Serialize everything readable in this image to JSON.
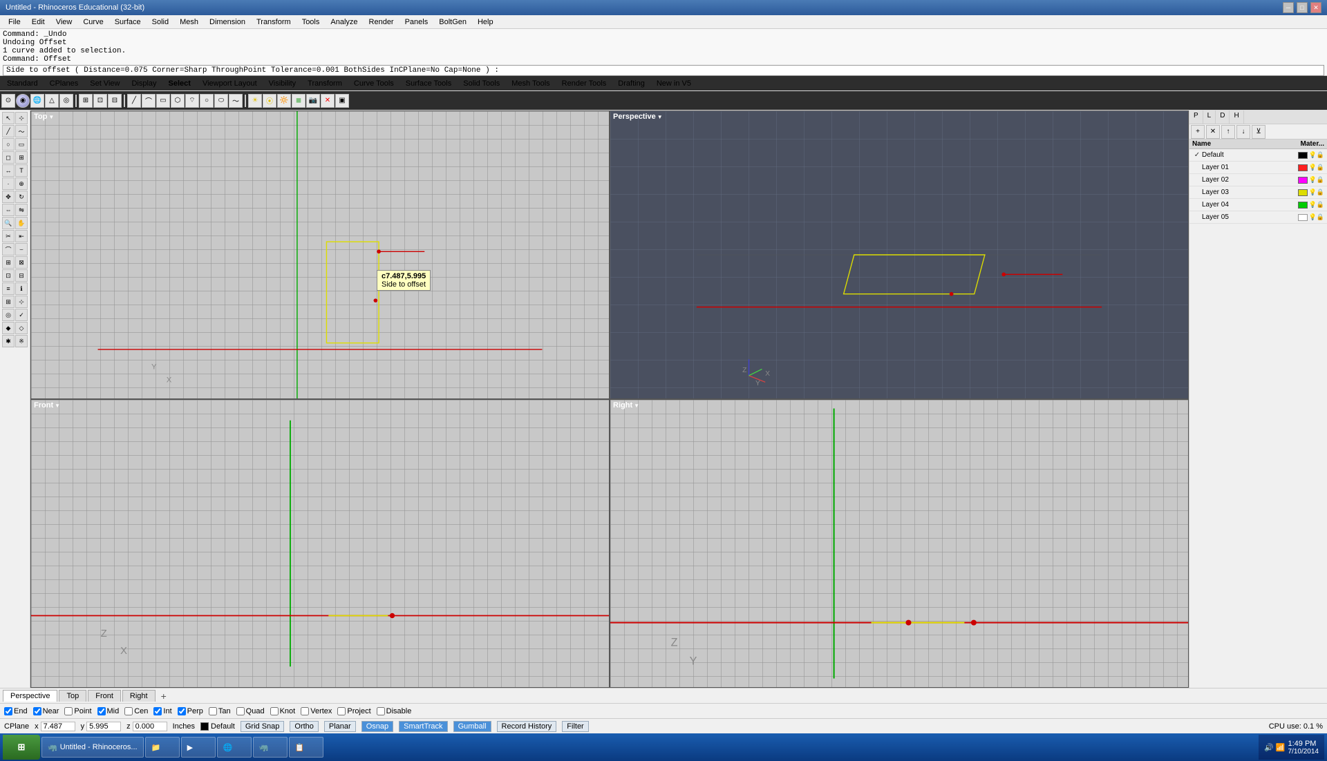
{
  "titlebar": {
    "title": "Untitled - Rhinoceros Educational (32-bit)",
    "controls": [
      "minimize",
      "maximize",
      "close"
    ]
  },
  "menubar": {
    "items": [
      "File",
      "Edit",
      "View",
      "Curve",
      "Surface",
      "Solid",
      "Mesh",
      "Dimension",
      "Transform",
      "Tools",
      "Analyze",
      "Render",
      "Panels",
      "BoltGen",
      "Help"
    ]
  },
  "command_area": {
    "line1": "Command: _Undo",
    "line2": "Undoing Offset",
    "line3": "1 curve added to selection.",
    "line4": "Command: Offset",
    "command_input": "Side to offset ( Distance=0.075  Corner=Sharp  ThroughPoint  Tolerance=0.001  BothSides  InCPlane=No  Cap=None ) :"
  },
  "toolbar_tabs": {
    "rows": [
      [
        "Standard",
        "CPlanes",
        "Set View",
        "Display",
        "Select",
        "Viewport Layout",
        "Visibility",
        "Transform",
        "Curve Tools",
        "Surface Tools",
        "Solid Tools",
        "Mesh Tools",
        "Render Tools",
        "Drafting",
        "New in V5"
      ],
      [
        "toolbar_buttons_row2"
      ]
    ]
  },
  "viewports": {
    "top": {
      "label": "Top",
      "arrow": "▼"
    },
    "perspective": {
      "label": "Perspective",
      "arrow": "▼"
    },
    "front": {
      "label": "Front",
      "arrow": "▼"
    },
    "right": {
      "label": "Right",
      "arrow": "▼"
    }
  },
  "tooltip": {
    "coord": "c7.487,5.995",
    "text": "Side to offset"
  },
  "layers": {
    "header_name": "Name",
    "header_material": "Mater...",
    "items": [
      {
        "name": "Default",
        "checked": true,
        "color": "#000000"
      },
      {
        "name": "Layer 01",
        "color": "#ff0000"
      },
      {
        "name": "Layer 02",
        "color": "#ff00ff"
      },
      {
        "name": "Layer 03",
        "color": "#ffff00"
      },
      {
        "name": "Layer 04",
        "color": "#00ff00"
      },
      {
        "name": "Layer 05",
        "color": "#ffffff"
      }
    ]
  },
  "bottom_tabs": {
    "tabs": [
      "Perspective",
      "Top",
      "Front",
      "Right"
    ],
    "active": "Perspective"
  },
  "statusbar": {
    "end": "End",
    "near": "Near",
    "point": "Point",
    "mid": "Mid",
    "cen": "Cen",
    "int": "Int",
    "perp": "Perp",
    "tan": "Tan",
    "quad": "Quad",
    "knot": "Knot",
    "vertex": "Vertex",
    "project": "Project",
    "disable": "Disable"
  },
  "coords_bar": {
    "cplane": "CPlane",
    "x_label": "x",
    "x_val": "7.487",
    "y_label": "y",
    "y_val": "5.995",
    "z_label": "z",
    "z_val": "0.000",
    "units": "Inches",
    "layer": "Default"
  },
  "snap_buttons": {
    "grid_snap": "Grid Snap",
    "ortho": "Ortho",
    "planar": "Planar",
    "osnap": "Osnap",
    "smart_track": "SmartTrack",
    "gumball": "Gumball",
    "record_history": "Record History",
    "filter": "Filter"
  },
  "system_tray": {
    "cpu": "CPU use: 0.1 %",
    "time": "1:49 PM",
    "date": "7/10/2014"
  },
  "taskbar_apps": [
    {
      "icon": "🪟",
      "label": "Untitled - Rhinoceros..."
    },
    {
      "icon": "📁",
      "label": ""
    },
    {
      "icon": "▶",
      "label": ""
    },
    {
      "icon": "🌐",
      "label": ""
    },
    {
      "icon": "🦏",
      "label": ""
    },
    {
      "icon": "📋",
      "label": ""
    }
  ]
}
